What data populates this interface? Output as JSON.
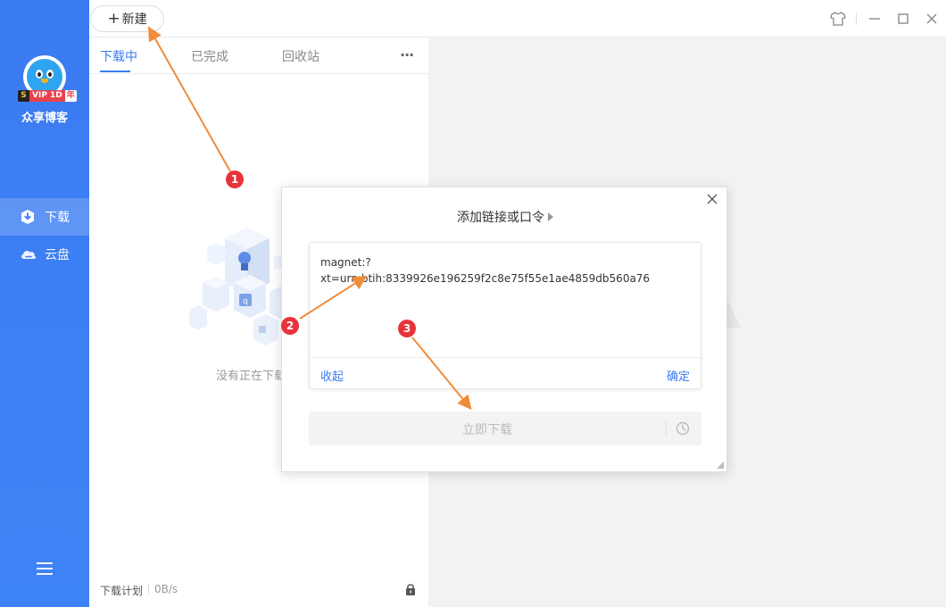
{
  "sidebar": {
    "vip": {
      "s": "S",
      "text": "VIP 1D",
      "year": "年"
    },
    "username": "众享博客",
    "nav": [
      {
        "label": "下载",
        "icon": "download-icon"
      },
      {
        "label": "云盘",
        "icon": "cloud-icon"
      }
    ],
    "menu_icon": "menu-icon"
  },
  "topbar": {
    "new_plus": "+",
    "new_label": "新建",
    "icons": [
      "skin-icon",
      "minimize-icon",
      "maximize-icon",
      "close-icon"
    ]
  },
  "panel": {
    "tabs": [
      "下载中",
      "已完成",
      "回收站"
    ],
    "more": "···",
    "empty_text": "没有正在下载",
    "footer": {
      "plan": "下载计划",
      "speed": "0B/s",
      "lock_icon": "lock-icon"
    }
  },
  "dialog": {
    "title": "添加链接或口令",
    "link_value": "magnet:?xt=urn:btih:8339926e196259f2c8e75f55e1ae4859db560a76",
    "collapse_label": "收起",
    "confirm_label": "确定",
    "download_now_label": "立即下载"
  },
  "annotations": [
    "1",
    "2",
    "3"
  ],
  "colors": {
    "accent": "#3a7cf3",
    "annotation_arrow": "#f08c3a",
    "annotation_badge": "#e8333b"
  }
}
